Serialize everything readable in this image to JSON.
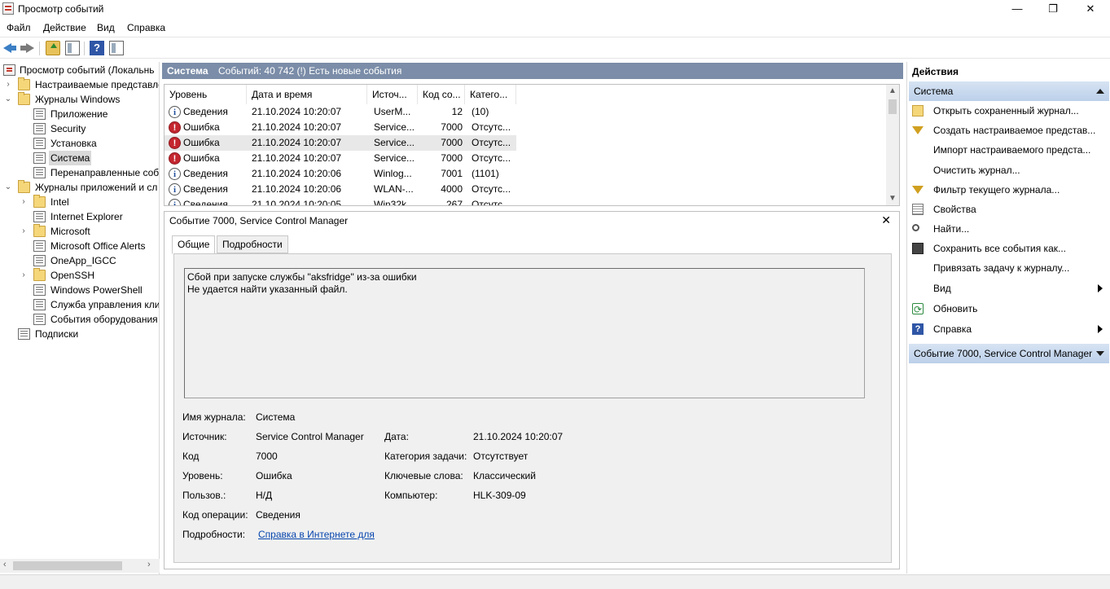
{
  "window": {
    "title": "Просмотр событий",
    "minimize": "—",
    "maximize": "❐",
    "close": "✕"
  },
  "menu": [
    "Файл",
    "Действие",
    "Вид",
    "Справка"
  ],
  "tree": [
    {
      "label": "Просмотр событий (Локальнь",
      "icon": "event-viewer-icon",
      "expander": ""
    },
    {
      "label": "Настраиваемые представле",
      "icon": "folder-icon",
      "expander": "›"
    },
    {
      "label": "Журналы Windows",
      "icon": "folder-icon",
      "expander": "⌄"
    },
    {
      "label": "Приложение",
      "icon": "log-icon",
      "expander": ""
    },
    {
      "label": "Security",
      "icon": "log-icon",
      "expander": ""
    },
    {
      "label": "Установка",
      "icon": "log-icon",
      "expander": ""
    },
    {
      "label": "Система",
      "icon": "log-icon",
      "expander": ""
    },
    {
      "label": "Перенаправленные соб",
      "icon": "log-icon",
      "expander": ""
    },
    {
      "label": "Журналы приложений и сл",
      "icon": "folder-icon",
      "expander": "⌄"
    },
    {
      "label": "Intel",
      "icon": "folder-icon",
      "expander": "›"
    },
    {
      "label": "Internet Explorer",
      "icon": "log-icon",
      "expander": ""
    },
    {
      "label": "Microsoft",
      "icon": "folder-icon",
      "expander": "›"
    },
    {
      "label": "Microsoft Office Alerts",
      "icon": "log-icon",
      "expander": ""
    },
    {
      "label": "OneApp_IGCC",
      "icon": "log-icon",
      "expander": ""
    },
    {
      "label": "OpenSSH",
      "icon": "folder-icon",
      "expander": "›"
    },
    {
      "label": "Windows PowerShell",
      "icon": "log-icon",
      "expander": ""
    },
    {
      "label": "Служба управления кли",
      "icon": "log-icon",
      "expander": ""
    },
    {
      "label": "События оборудования",
      "icon": "log-icon",
      "expander": ""
    },
    {
      "label": "Подписки",
      "icon": "log-icon",
      "expander": ""
    }
  ],
  "header": {
    "log_name": "Система",
    "summary": "Событий: 40 742 (!) Есть новые события"
  },
  "columns": [
    "Уровень",
    "Дата и время",
    "Источ...",
    "Код со...",
    "Катего..."
  ],
  "events": [
    {
      "level": "Сведения",
      "type": "info",
      "datetime": "21.10.2024 10:20:07",
      "source": "UserM...",
      "code": "12",
      "category": "(10)"
    },
    {
      "level": "Ошибка",
      "type": "error",
      "datetime": "21.10.2024 10:20:07",
      "source": "Service...",
      "code": "7000",
      "category": "Отсутс..."
    },
    {
      "level": "Ошибка",
      "type": "error",
      "datetime": "21.10.2024 10:20:07",
      "source": "Service...",
      "code": "7000",
      "category": "Отсутс..."
    },
    {
      "level": "Ошибка",
      "type": "error",
      "datetime": "21.10.2024 10:20:07",
      "source": "Service...",
      "code": "7000",
      "category": "Отсутс..."
    },
    {
      "level": "Сведения",
      "type": "info",
      "datetime": "21.10.2024 10:20:06",
      "source": "Winlog...",
      "code": "7001",
      "category": "(1101)"
    },
    {
      "level": "Сведения",
      "type": "info",
      "datetime": "21.10.2024 10:20:06",
      "source": "WLAN-...",
      "code": "4000",
      "category": "Отсутс..."
    },
    {
      "level": "Сведения",
      "type": "info",
      "datetime": "21.10.2024 10:20:05",
      "source": "Win32k",
      "code": "267",
      "category": "Отсутс..."
    }
  ],
  "detail": {
    "title": "Событие 7000, Service Control Manager",
    "close": "✕",
    "tabs": [
      "Общие",
      "Подробности"
    ],
    "message_line1": "Сбой при запуске службы \"aksfridge\" из-за ошибки",
    "message_line2": "Не удается найти указанный файл.",
    "labels": {
      "log_name": "Имя журнала:",
      "source": "Источник:",
      "code": "Код",
      "level": "Уровень:",
      "user": "Пользов.:",
      "opcode": "Код операции:",
      "details": "Подробности:",
      "date": "Дата:",
      "task_category": "Категория задачи:",
      "keywords": "Ключевые слова:",
      "computer": "Компьютер:"
    },
    "values": {
      "log_name": "Система",
      "source": "Service Control Manager",
      "code": "7000",
      "level": "Ошибка",
      "user": "Н/Д",
      "opcode": "Сведения",
      "details_link": "Справка в Интернете для ",
      "date": "21.10.2024 10:20:07",
      "task_category": "Отсутствует",
      "keywords": "Классический",
      "computer": "HLK-309-09"
    }
  },
  "actions": {
    "title": "Действия",
    "section1": "Система",
    "items": [
      {
        "label": "Открыть сохраненный журнал...",
        "icon": "open-log-icon",
        "submenu": false
      },
      {
        "label": "Создать настраиваемое представ...",
        "icon": "create-view-icon",
        "submenu": false
      },
      {
        "label": "Импорт настраиваемого предста...",
        "icon": "",
        "submenu": false
      },
      {
        "label": "Очистить журнал...",
        "icon": "",
        "submenu": false
      },
      {
        "label": "Фильтр текущего журнала...",
        "icon": "filter-icon",
        "submenu": false
      },
      {
        "label": "Свойства",
        "icon": "properties-icon",
        "submenu": false
      },
      {
        "label": "Найти...",
        "icon": "find-icon",
        "submenu": false
      },
      {
        "label": "Сохранить все события как...",
        "icon": "save-icon",
        "submenu": false
      },
      {
        "label": "Привязать задачу к журналу...",
        "icon": "",
        "submenu": false
      },
      {
        "label": "Вид",
        "icon": "",
        "submenu": true
      },
      {
        "label": "Обновить",
        "icon": "refresh-icon",
        "submenu": false
      },
      {
        "label": "Справка",
        "icon": "help-icon",
        "submenu": true
      }
    ],
    "section2": "Событие 7000, Service Control Manager"
  },
  "colors": {
    "header_bg": "#7b8da8",
    "section_bg": "#c6d7ee",
    "error": "#c4262e",
    "link": "#0645ad"
  }
}
